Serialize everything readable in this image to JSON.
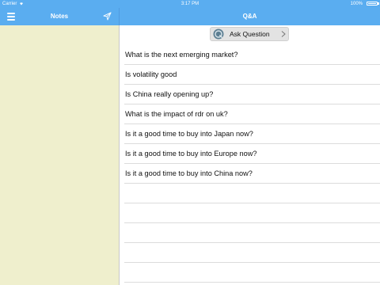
{
  "status_bar": {
    "carrier": "Carrier",
    "time": "3:17 PM",
    "battery": "100%"
  },
  "nav": {
    "notes_title": "Notes",
    "qa_title": "Q&A",
    "menu_icon": "hamburger-menu-icon",
    "send_icon": "paper-plane-icon"
  },
  "qa": {
    "ask_button_label": "Ask Question",
    "ask_icon": "question-bubble-icon",
    "questions": [
      "What is the next emerging market?",
      "Is volatility good",
      "Is China really opening up?",
      "What is the impact of rdr on uk?",
      "Is it a good time to buy into Japan now?",
      "Is it a good time to buy into Europe now?",
      "Is it a good time to buy into China now?"
    ]
  },
  "colors": {
    "accent": "#5aadf0",
    "notes_background": "#efefcd",
    "row_separator": "#dcdcdc"
  }
}
